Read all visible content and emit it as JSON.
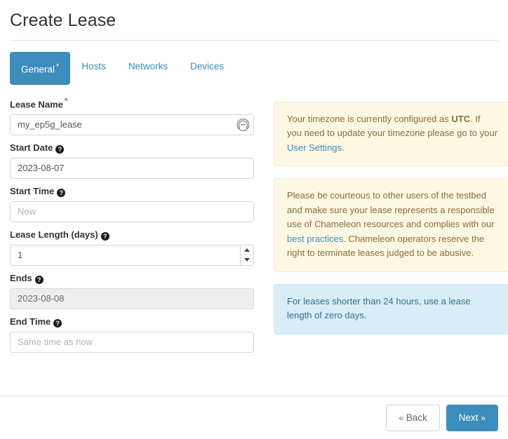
{
  "header": {
    "title": "Create Lease"
  },
  "tabs": [
    {
      "label": "General",
      "required_marker": "*",
      "active": true
    },
    {
      "label": "Hosts",
      "required_marker": "",
      "active": false
    },
    {
      "label": "Networks",
      "required_marker": "",
      "active": false
    },
    {
      "label": "Devices",
      "required_marker": "",
      "active": false
    }
  ],
  "form": {
    "lease_name": {
      "label": "Lease Name",
      "required_marker": "*",
      "value": "my_ep5g_lease",
      "placeholder": "",
      "icon": "password-manager-icon"
    },
    "start_date": {
      "label": "Start Date",
      "help_glyph": "?",
      "value": "2023-08-07",
      "placeholder": ""
    },
    "start_time": {
      "label": "Start Time",
      "help_glyph": "?",
      "value": "",
      "placeholder": "Now"
    },
    "lease_length": {
      "label": "Lease Length (days)",
      "help_glyph": "?",
      "value": "1",
      "placeholder": "",
      "stepper_up": "increment-icon",
      "stepper_down": "decrement-icon"
    },
    "ends": {
      "label": "Ends",
      "help_glyph": "?",
      "value": "2023-08-08",
      "placeholder": "",
      "disabled": true
    },
    "end_time": {
      "label": "End Time",
      "help_glyph": "?",
      "value": "",
      "placeholder": "Same time as now"
    }
  },
  "alerts": {
    "timezone": {
      "text_before": "Your timezone is currently configured as ",
      "emphasis": "UTC",
      "text_middle": ". If you need to update your timezone please go to your ",
      "link": "User Settings",
      "text_after": "."
    },
    "courtesy": {
      "text_before": "Please be courteous to other users of the testbed and make sure your lease represents a responsible use of Chameleon resources and complies with our ",
      "link": "best practices",
      "text_after": ". Chameleon operators reserve the right to terminate leases judged to be abusive."
    },
    "short_lease": {
      "text": "For leases shorter than 24 hours, use a lease length of zero days."
    }
  },
  "footer": {
    "back_chevron": "«",
    "back_label": "Back",
    "next_label": "Next",
    "next_chevron": "»"
  },
  "colors": {
    "accent_blue": "#3c8dbc",
    "warning_bg": "#fcf8e3",
    "info_bg": "#d9edf7",
    "disabled_bg": "#eeeeee"
  }
}
